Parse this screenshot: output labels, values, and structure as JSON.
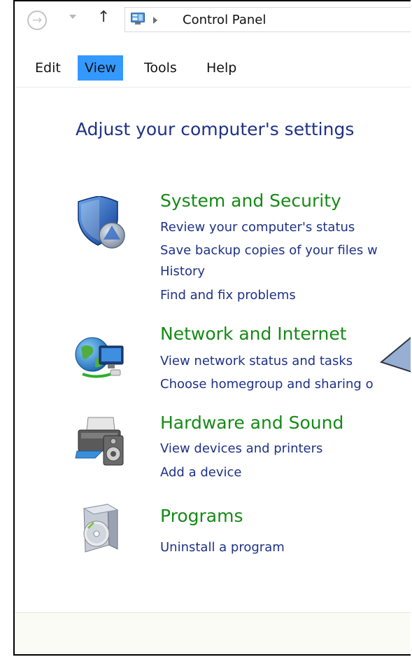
{
  "address_bar": {
    "back_icon": "back-arrow-circle-icon",
    "recent_icon": "dropdown-arrow-icon",
    "up_icon": "up-arrow-icon",
    "location_icon": "control-panel-icon",
    "breadcrumb": "Control Panel"
  },
  "menu": {
    "items": [
      {
        "label": "Edit"
      },
      {
        "label": "View",
        "selected": true
      },
      {
        "label": "Tools"
      },
      {
        "label": "Help"
      }
    ]
  },
  "main": {
    "heading": "Adjust your computer's settings",
    "categories": [
      {
        "title": "System and Security",
        "icon": "shield-icon",
        "links": [
          "Review your computer's status",
          "Save backup copies of your files w",
          "History",
          "Find and fix problems"
        ]
      },
      {
        "title": "Network and Internet",
        "icon": "globe-network-icon",
        "links": [
          "View network status and tasks",
          "Choose homegroup and sharing o"
        ]
      },
      {
        "title": "Hardware and Sound",
        "icon": "printer-speaker-icon",
        "links": [
          "View devices and printers",
          "Add a device"
        ]
      },
      {
        "title": "Programs",
        "icon": "programs-disc-icon",
        "links": [
          "Uninstall a program"
        ]
      }
    ]
  },
  "colors": {
    "heading": "#1e3287",
    "category_title": "#168a16",
    "link": "#1e3287",
    "menu_selected": "#3399ff",
    "callout_fill": "#96afd2"
  }
}
